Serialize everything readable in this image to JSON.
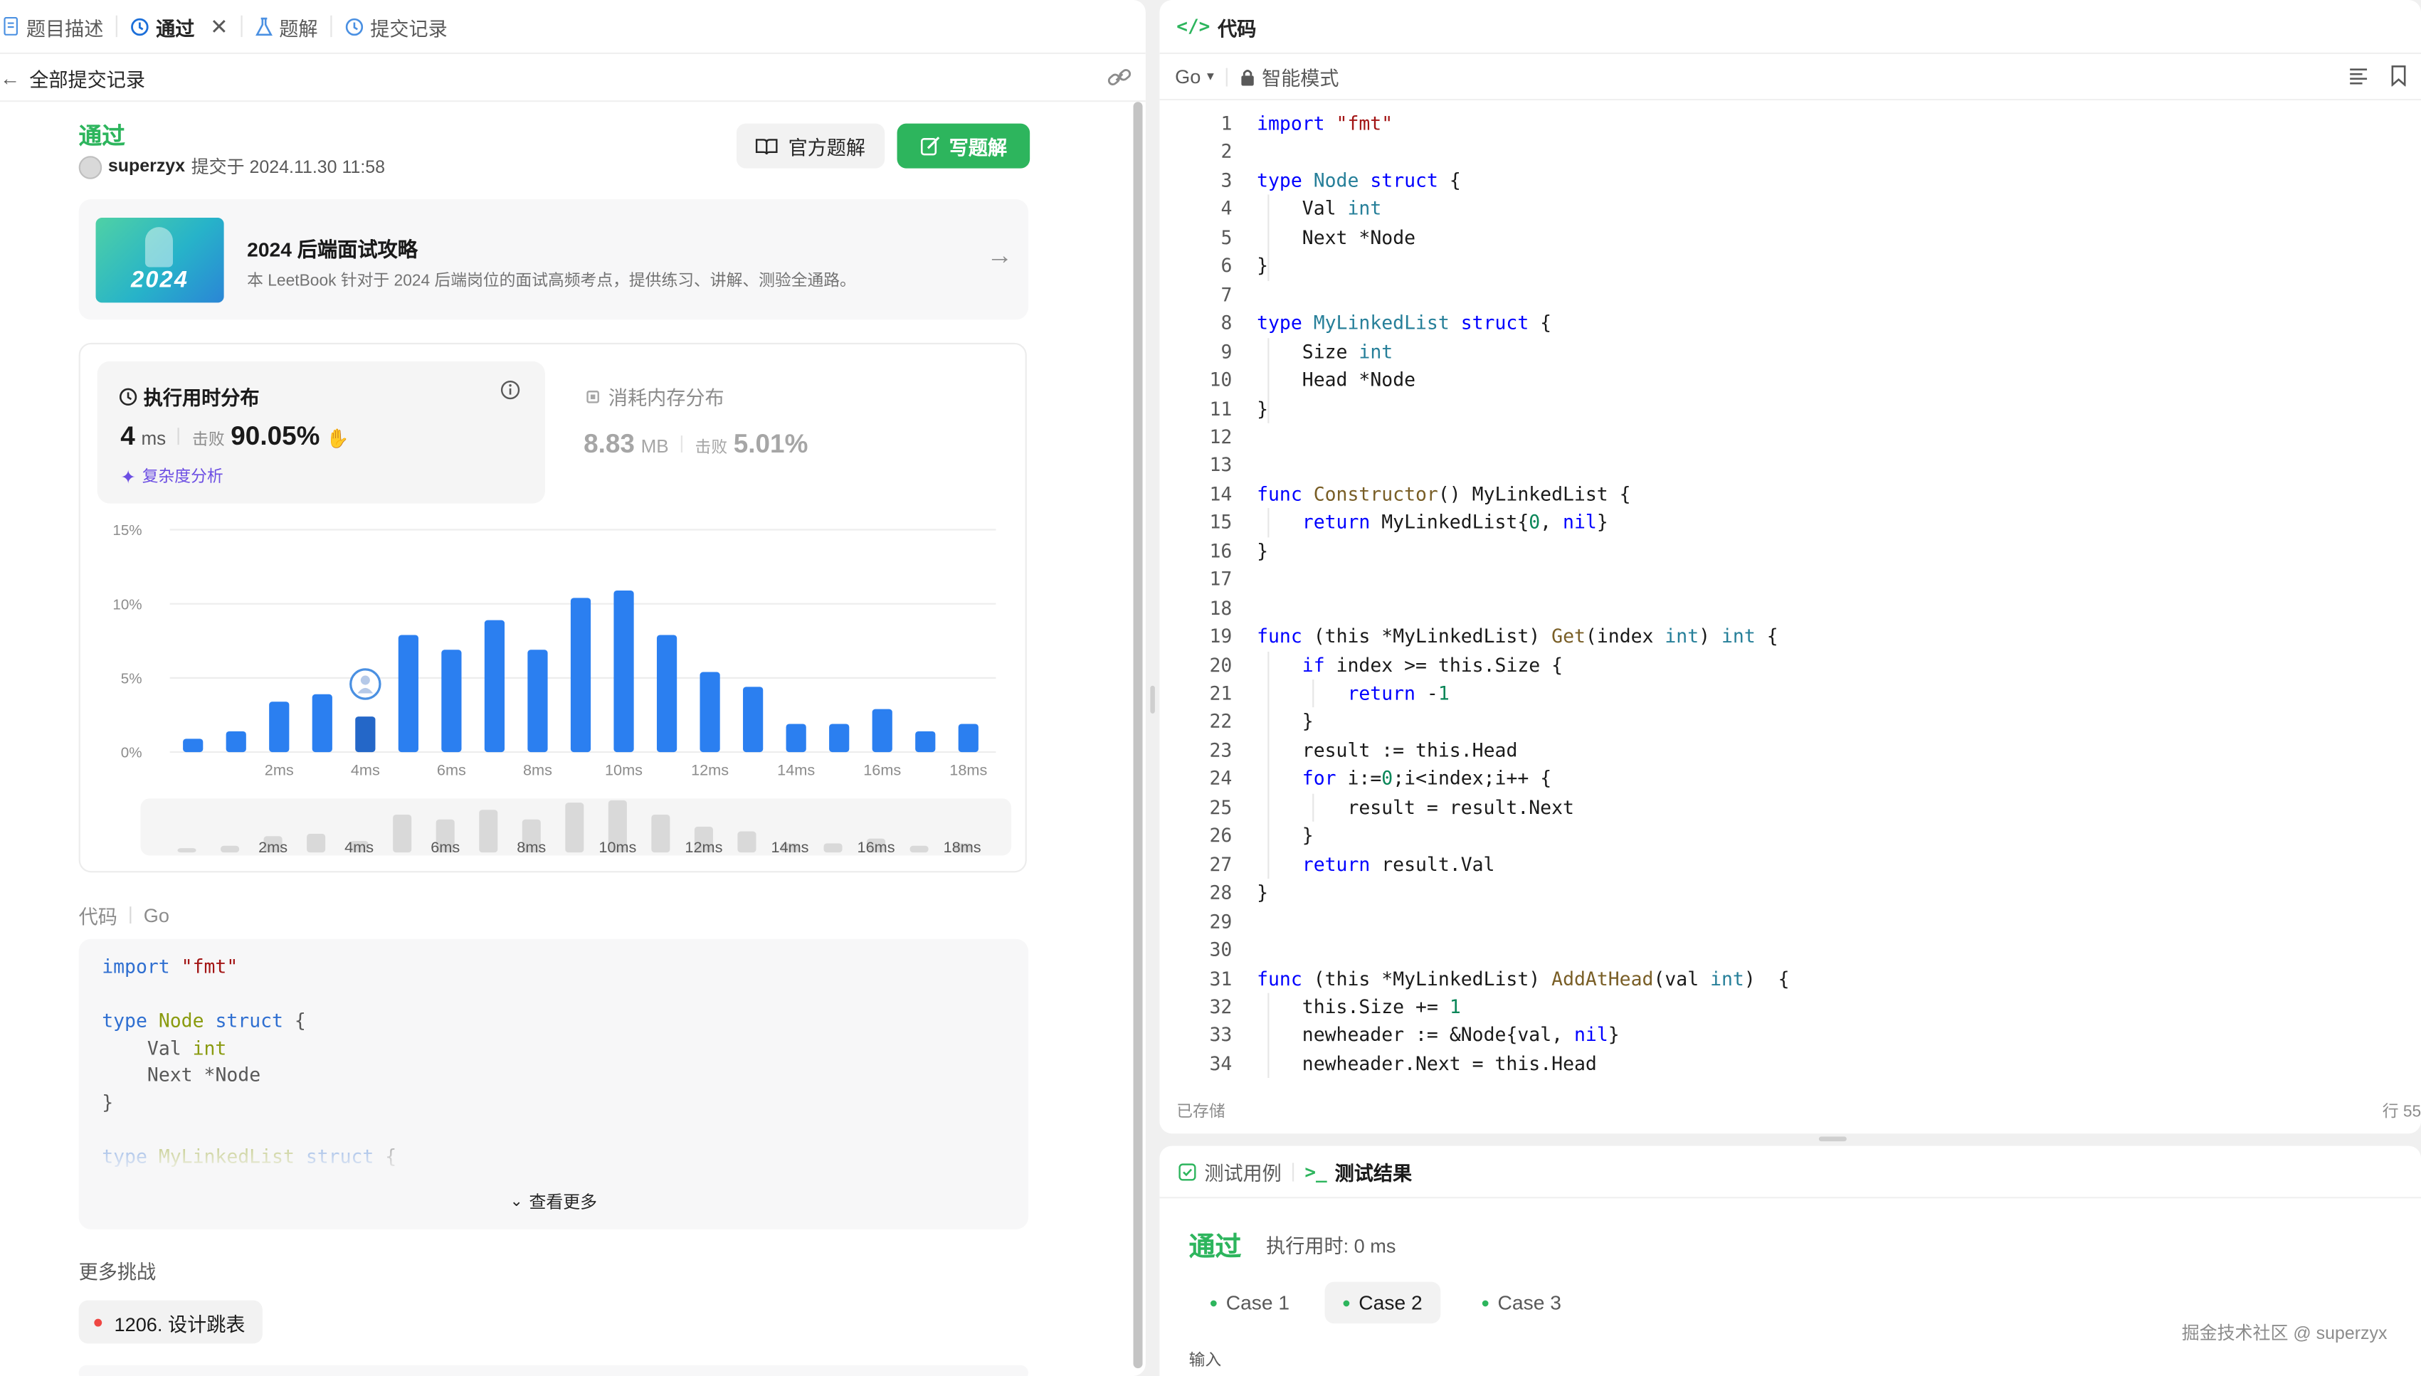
{
  "left_panel": {
    "tabs": [
      {
        "label": "题目描述",
        "icon": "document-icon"
      },
      {
        "label": "通过",
        "icon": "history-icon",
        "closable": true
      },
      {
        "label": "题解",
        "icon": "flask-icon"
      },
      {
        "label": "提交记录",
        "icon": "history-icon"
      }
    ],
    "back_label": "全部提交记录",
    "submission": {
      "status": "通过",
      "user": "superzyx",
      "submitted_text": "提交于 2024.11.30 11:58",
      "official_solution_button": "官方题解",
      "write_solution_button": "写题解"
    },
    "promo": {
      "title": "2024 后端面试攻略",
      "desc": "本 LeetBook 针对于 2024 后端岗位的面试高频考点，提供练习、讲解、测验全通路。",
      "image_text": "2024"
    },
    "stats": {
      "runtime_title": "执行用时分布",
      "runtime_value": "4",
      "runtime_unit": "ms",
      "beats_label": "击败",
      "runtime_beats": "90.05%",
      "complexity_link": "复杂度分析",
      "memory_title": "消耗内存分布",
      "memory_value": "8.83",
      "memory_unit": "MB",
      "memory_beats": "5.01%"
    },
    "code_section": {
      "label": "代码",
      "language": "Go",
      "preview_lines": [
        "import \"fmt\"",
        "",
        "type Node struct {",
        "    Val int",
        "    Next *Node",
        "}",
        "",
        "type MyLinkedList struct {"
      ],
      "show_more": "查看更多"
    },
    "more_challenges": {
      "label": "更多挑战",
      "item": "1206. 设计跳表"
    }
  },
  "chart_data": {
    "type": "bar",
    "title": "",
    "xlabel": "",
    "ylabel": "",
    "ylim": [
      0,
      15
    ],
    "y_ticks": [
      "15%",
      "10%",
      "5%",
      "0%"
    ],
    "x_tick_labels": [
      "2ms",
      "4ms",
      "6ms",
      "8ms",
      "10ms",
      "12ms",
      "14ms",
      "16ms",
      "18ms"
    ],
    "values": [
      0.9,
      1.4,
      3.4,
      3.9,
      2.4,
      7.9,
      6.9,
      8.9,
      6.9,
      10.4,
      10.9,
      7.9,
      5.4,
      4.4,
      1.9,
      1.9,
      2.9,
      1.4,
      1.9
    ],
    "highlight_index": 4,
    "bar_color": "#2b7ff0",
    "highlight_color": "#2467c8",
    "overview_values": [
      0.9,
      1.4,
      3.4,
      3.9,
      2.4,
      7.9,
      6.9,
      8.9,
      6.9,
      10.4,
      10.9,
      7.9,
      5.4,
      4.4,
      1.9,
      1.9,
      2.9,
      1.4,
      1.9
    ],
    "overview_tick_labels": [
      "2ms",
      "4ms",
      "6ms",
      "8ms",
      "10ms",
      "12ms",
      "14ms",
      "16ms",
      "18ms"
    ]
  },
  "editor": {
    "title": "代码",
    "language": "Go",
    "mode": "智能模式",
    "saved": "已存储",
    "cursor": "行 55",
    "lines": [
      "import \"fmt\"",
      "",
      "type Node struct {",
      "    Val int",
      "    Next *Node",
      "}",
      "",
      "type MyLinkedList struct {",
      "    Size int",
      "    Head *Node",
      "}",
      "",
      "",
      "func Constructor() MyLinkedList {",
      "    return MyLinkedList{0, nil}",
      "}",
      "",
      "",
      "func (this *MyLinkedList) Get(index int) int {",
      "    if index >= this.Size {",
      "        return -1",
      "    }",
      "    result := this.Head",
      "    for i:=0;i<index;i++ {",
      "        result = result.Next",
      "    }",
      "    return result.Val",
      "}",
      "",
      "",
      "func (this *MyLinkedList) AddAtHead(val int)  {",
      "    this.Size += 1",
      "    newheader := &Node{val, nil}",
      "    newheader.Next = this.Head"
    ]
  },
  "result_panel": {
    "tab_test_cases": "测试用例",
    "tab_test_result": "测试结果",
    "status": "通过",
    "runtime": "执行用时: 0 ms",
    "cases": [
      "Case 1",
      "Case 2",
      "Case 3"
    ],
    "selected_case": 1,
    "input_label": "输入",
    "watermark": "掘金技术社区 @ superzyx"
  }
}
